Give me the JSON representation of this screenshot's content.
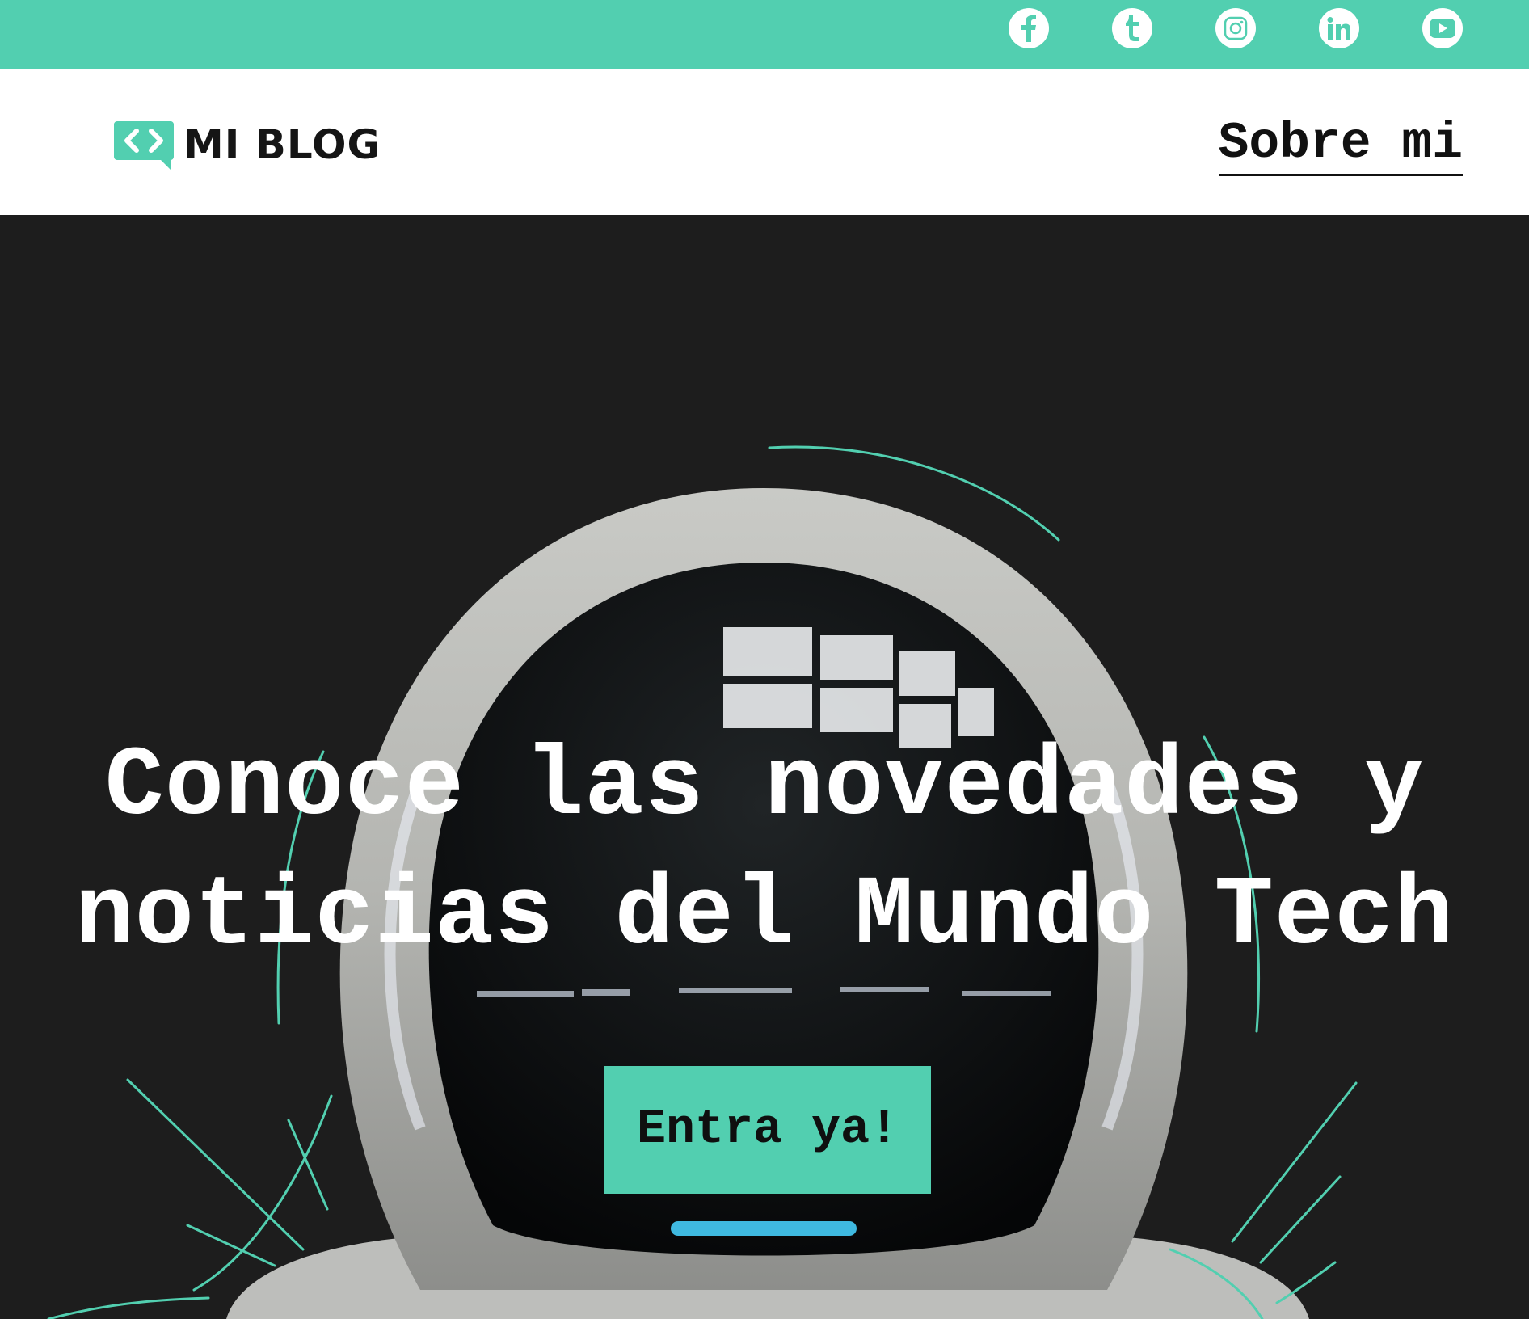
{
  "social": [
    {
      "name": "facebook",
      "icon": "facebook-icon"
    },
    {
      "name": "tumblr",
      "icon": "tumblr-icon"
    },
    {
      "name": "instagram",
      "icon": "instagram-icon"
    },
    {
      "name": "linkedin",
      "icon": "linkedin-icon"
    },
    {
      "name": "youtube",
      "icon": "youtube-icon"
    }
  ],
  "header": {
    "logo_text": "MI BLOG",
    "logo_icon": "code-chat-bubble-icon",
    "nav": {
      "about_label": "Sobre mi"
    }
  },
  "hero": {
    "title_line1": "Conoce las novedades y",
    "title_line2": "noticias del Mundo Tech",
    "cta_label": "Entra ya!",
    "background": "astronaut-helmet-photo"
  },
  "colors": {
    "accent": "#52cfb0",
    "text_dark": "#111111",
    "hero_bg": "#1d1d1d"
  }
}
